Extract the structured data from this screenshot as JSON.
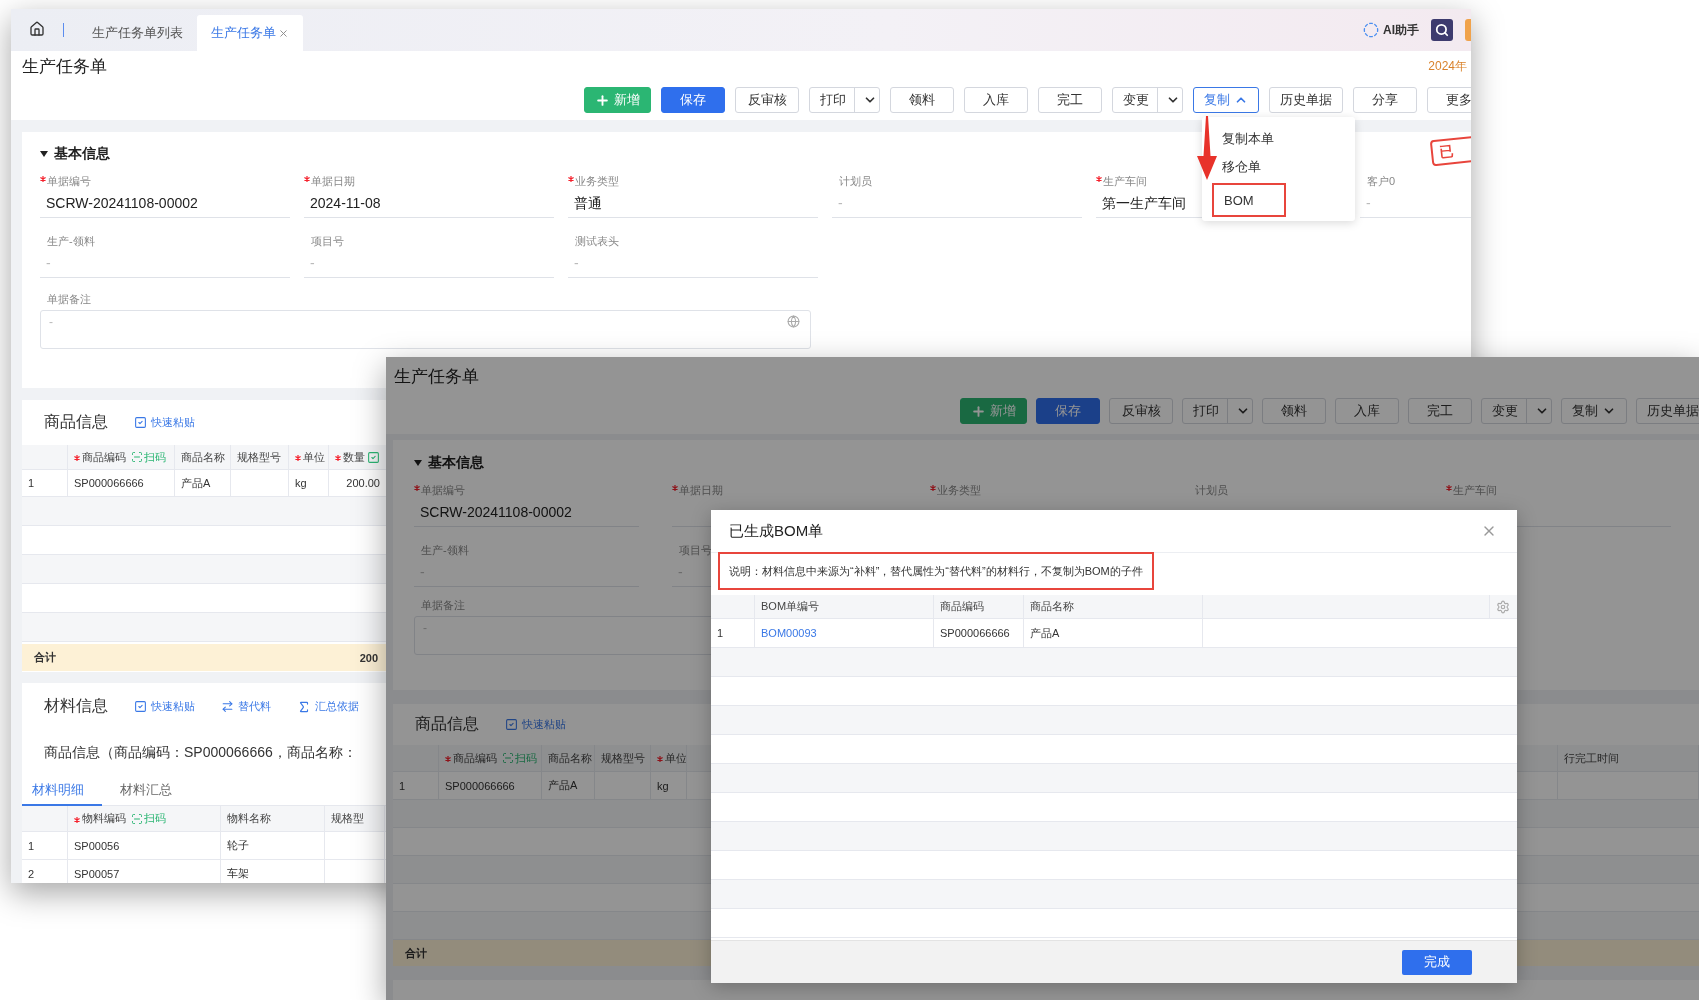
{
  "back_window": {
    "tabs": [
      {
        "label": "生产任务单列表",
        "selected": false,
        "closable": false
      },
      {
        "label": "生产任务单",
        "selected": true,
        "closable": true
      }
    ],
    "assistant": "AI助手",
    "year": "2024年",
    "title": "生产任务单",
    "toolbar": [
      {
        "label": "新增",
        "kind": "add"
      },
      {
        "label": "保存",
        "kind": "primary"
      },
      {
        "label": "反审核",
        "kind": "plain"
      },
      {
        "label": "打印",
        "kind": "split"
      },
      {
        "label": "领料",
        "kind": "plain"
      },
      {
        "label": "入库",
        "kind": "plain"
      },
      {
        "label": "完工",
        "kind": "plain"
      },
      {
        "label": "变更",
        "kind": "split"
      },
      {
        "label": "复制",
        "kind": "menu",
        "expanded": true
      },
      {
        "label": "历史单据",
        "kind": "plain"
      },
      {
        "label": "分享",
        "kind": "plain"
      },
      {
        "label": "更多",
        "kind": "plain"
      }
    ],
    "copy_menu": [
      {
        "label": "复制本单",
        "highlighted": false
      },
      {
        "label": "移仓单",
        "highlighted": false
      },
      {
        "label": "BOM",
        "highlighted": true
      }
    ],
    "stamp": "已",
    "basic_info": {
      "title": "基本信息",
      "expanded": true,
      "rows": [
        [
          {
            "label": "单据编号",
            "required": true,
            "value": "SCRW-20241108-00002"
          },
          {
            "label": "单据日期",
            "required": true,
            "value": "2024-11-08"
          },
          {
            "label": "业务类型",
            "required": true,
            "value": "普通"
          },
          {
            "label": "计划员",
            "required": false,
            "value": "-"
          },
          {
            "label": "生产车间",
            "required": true,
            "value": "第一生产车间"
          },
          {
            "label": "客户0",
            "required": false,
            "value": "-"
          }
        ],
        [
          {
            "label": "生产-领料",
            "required": false,
            "value": "-"
          },
          {
            "label": "项目号",
            "required": false,
            "value": "-"
          },
          {
            "label": "测试表头",
            "required": false,
            "value": "-"
          }
        ]
      ],
      "remark": {
        "label": "单据备注",
        "value": "-"
      }
    },
    "goods_info": {
      "title": "商品信息",
      "actions": [
        {
          "label": "快速粘贴",
          "kind": "paste"
        }
      ],
      "columns": [
        {
          "label": "商品编码",
          "required": true,
          "scan": "扫码"
        },
        {
          "label": "商品名称",
          "required": false
        },
        {
          "label": "规格型号",
          "required": false
        },
        {
          "label": "单位",
          "required": true
        },
        {
          "label": "数量",
          "required": true,
          "checkable": true
        }
      ],
      "rows": [
        {
          "index": "1",
          "cells": [
            "SP000066666",
            "产品A",
            null,
            "kg",
            "200.00"
          ]
        }
      ],
      "total_label": "合计",
      "total": "200"
    },
    "materials": {
      "title": "材料信息",
      "actions": [
        {
          "label": "快速粘贴",
          "kind": "paste"
        },
        {
          "label": "替代料",
          "kind": "swap"
        },
        {
          "label": "汇总依据",
          "kind": "sum"
        }
      ],
      "context": "商品信息（商品编码：SP000066666，商品名称：",
      "tabs": [
        {
          "label": "材料明细",
          "selected": true
        },
        {
          "label": "材料汇总",
          "selected": false
        }
      ],
      "columns": [
        {
          "label": "物料编码",
          "required": true,
          "scan": "扫码"
        },
        {
          "label": "物料名称",
          "required": false
        },
        {
          "label": "规格型",
          "required": false
        }
      ],
      "rows": [
        {
          "index": "1",
          "cells": [
            "SP00056",
            "轮子",
            null
          ]
        },
        {
          "index": "2",
          "cells": [
            "SP00057",
            "车架",
            null
          ]
        }
      ]
    }
  },
  "front_window": {
    "dimmed": true,
    "title": "生产任务单",
    "toolbar": [
      {
        "label": "新增",
        "kind": "add"
      },
      {
        "label": "保存",
        "kind": "primary"
      },
      {
        "label": "反审核",
        "kind": "plain"
      },
      {
        "label": "打印",
        "kind": "split"
      },
      {
        "label": "领料",
        "kind": "plain"
      },
      {
        "label": "入库",
        "kind": "plain"
      },
      {
        "label": "完工",
        "kind": "plain"
      },
      {
        "label": "变更",
        "kind": "split"
      },
      {
        "label": "复制",
        "kind": "menu",
        "expanded": false
      },
      {
        "label": "历史单据",
        "kind": "plain"
      }
    ],
    "basic_info": {
      "title": "基本信息",
      "expanded": true,
      "rows": [
        [
          {
            "label": "单据编号",
            "required": true,
            "value": "SCRW-20241108-00002"
          },
          {
            "label": "单据日期",
            "required": true
          },
          {
            "label": "业务类型",
            "required": true
          },
          {
            "label": "计划员",
            "required": false
          },
          {
            "label": "生产车间",
            "required": true
          }
        ],
        [
          {
            "label": "生产-领料",
            "required": false,
            "value": "-"
          },
          {
            "label": "项目号",
            "required": false,
            "value": "-"
          }
        ]
      ],
      "remark": {
        "label": "单据备注",
        "value": "-"
      }
    },
    "goods_info": {
      "title": "商品信息",
      "actions": [
        {
          "label": "快速粘贴",
          "kind": "paste"
        }
      ],
      "columns": [
        {
          "label": "商品编码",
          "required": true,
          "scan": "扫码"
        },
        {
          "label": "商品名称",
          "required": false
        },
        {
          "label": "规格型号",
          "required": false
        },
        {
          "label": "单位",
          "required": true
        }
      ],
      "trailing_column": "行完工时间",
      "rows": [
        {
          "index": "1",
          "cells": [
            "SP000066666",
            "产品A",
            null,
            "kg"
          ]
        }
      ],
      "total_label": "合计"
    }
  },
  "dialog": {
    "title": "已生成BOM单",
    "note": "说明：材料信息中来源为“补料”，替代属性为“替代料”的材料行，不复制为BOM的子件",
    "note_highlighted": true,
    "columns": [
      "BOM单编号",
      "商品编码",
      "商品名称"
    ],
    "rows": [
      {
        "index": "1",
        "bom_no": "BOM00093",
        "code": "SP000066666",
        "name": "产品A"
      }
    ],
    "confirm": "完成"
  }
}
